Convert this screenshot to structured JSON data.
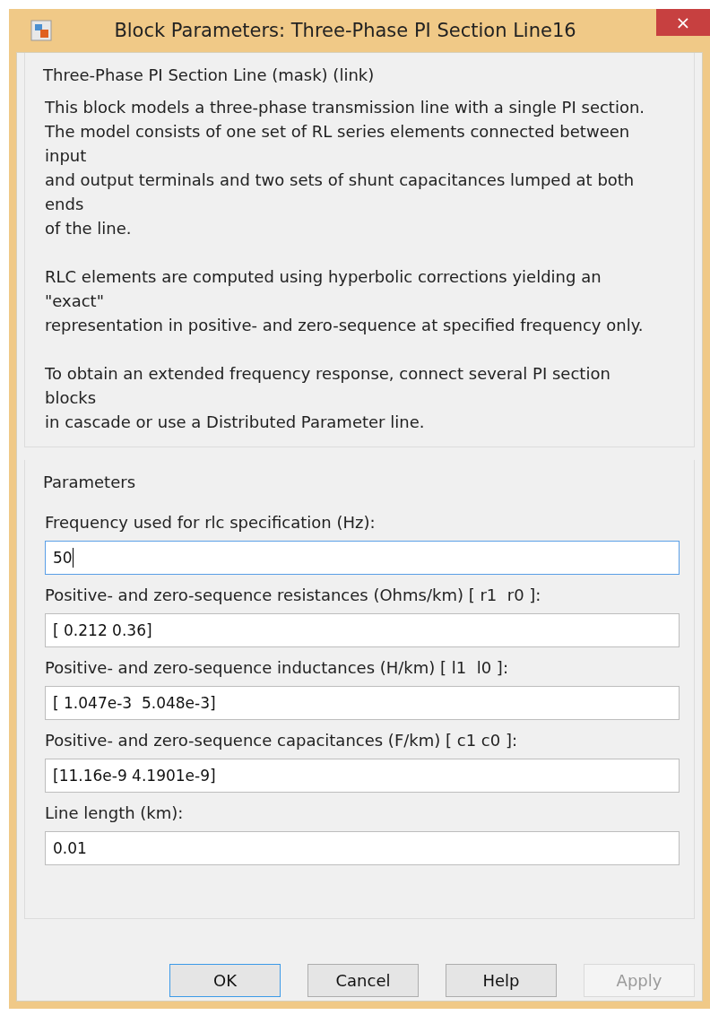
{
  "window": {
    "title": "Block Parameters: Three-Phase PI Section Line16",
    "close": "×"
  },
  "description": {
    "title": "Three-Phase PI Section Line (mask) (link)",
    "paragraphs": [
      [
        "This block models a three-phase transmission line with a single PI section.",
        "The model consists of one set of RL series elements connected between",
        "input",
        "and output terminals and two sets of shunt capacitances lumped at both",
        "ends",
        "of the line."
      ],
      [
        "RLC elements are computed using hyperbolic corrections yielding an",
        "\"exact\"",
        "representation in positive- and zero-sequence at specified frequency only."
      ],
      [
        "To obtain an extended frequency response, connect several PI section",
        "blocks",
        "in cascade or use a Distributed Parameter line."
      ]
    ]
  },
  "parameters": {
    "title": "Parameters",
    "fields": [
      {
        "label": "Frequency used for rlc specification (Hz):",
        "value": "50",
        "focused": true
      },
      {
        "label": "Positive- and zero-sequence resistances (Ohms/km) [ r1  r0 ]:",
        "value": "[ 0.212 0.36]",
        "focused": false
      },
      {
        "label": "Positive- and zero-sequence inductances (H/km) [ l1  l0 ]:",
        "value": "[ 1.047e-3  5.048e-3]",
        "focused": false
      },
      {
        "label": "Positive- and zero-sequence capacitances (F/km) [ c1 c0 ]:",
        "value": "[11.16e-9 4.1901e-9]",
        "focused": false
      },
      {
        "label": "Line length (km):",
        "value": "0.01",
        "focused": false
      }
    ]
  },
  "buttons": [
    {
      "label": "OK",
      "default": true,
      "disabled": false
    },
    {
      "label": "Cancel",
      "default": false,
      "disabled": false
    },
    {
      "label": "Help",
      "default": false,
      "disabled": false
    },
    {
      "label": "Apply",
      "default": false,
      "disabled": true
    }
  ]
}
